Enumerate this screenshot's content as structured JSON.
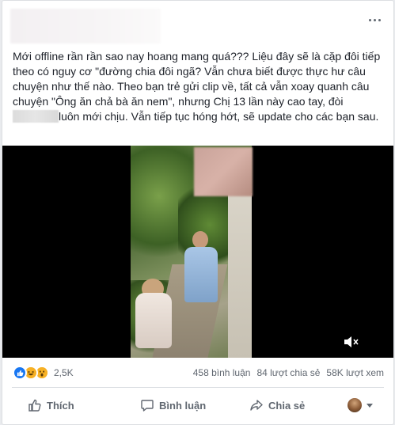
{
  "post": {
    "text_before": "Mới offline rần rần sao nay hoang mang quá??? Liệu đây sẽ là cặp đôi tiếp theo có nguy cơ \"đường chia đôi ngã? Vẫn chưa biết được thực hư câu chuyện như thế nào. Theo bạn trẻ gửi clip về, tất cả vẫn xoay quanh câu chuyện \"Ông ăn chả bà ăn nem\", nhưng Chị 13 lần này cao tay, đòi",
    "text_after": "luôn mới chịu. Vẫn tiếp tục hóng hớt, sẽ update cho các bạn sau."
  },
  "video": {
    "mute_icon": "speaker-mute-icon"
  },
  "reactions": {
    "icons": [
      "like-reaction-icon",
      "haha-reaction-icon",
      "wow-reaction-icon"
    ],
    "count": "2,5K"
  },
  "stats": {
    "comments": "458 bình luận",
    "shares": "84 lượt chia sẻ",
    "views": "58K lượt xem"
  },
  "actions": {
    "like_label": "Thích",
    "comment_label": "Bình luận",
    "share_label": "Chia sẻ"
  },
  "colors": {
    "accent": "#1877f2",
    "secondary_text": "#606770",
    "haha_wow": "#f7b125"
  }
}
